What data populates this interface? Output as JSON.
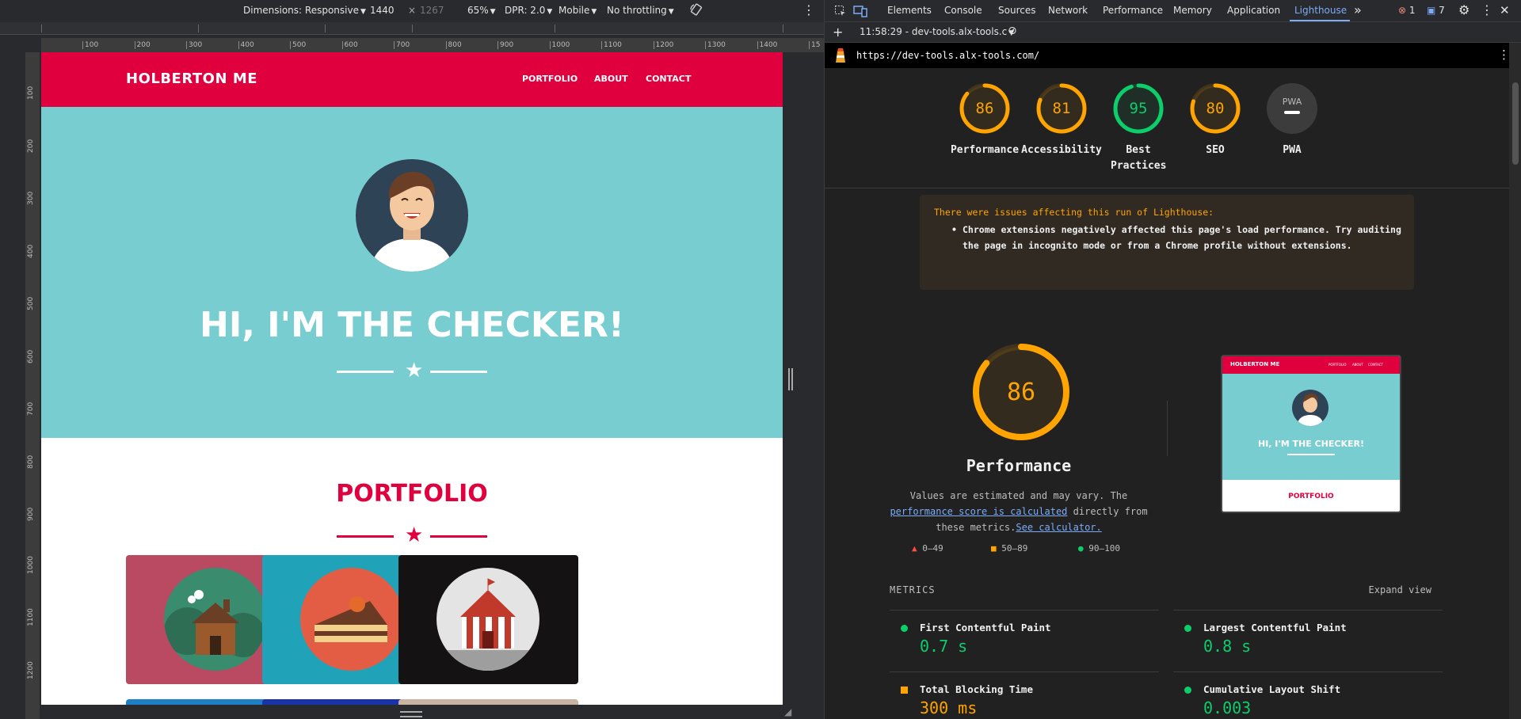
{
  "device_toolbar": {
    "dimensions_label": "Dimensions: Responsive",
    "width": "1440",
    "times": "×",
    "height": "1267",
    "zoom": "65%",
    "dpr": "DPR: 2.0",
    "device_type": "Mobile",
    "throttling": "No throttling"
  },
  "rulers": {
    "h_ticks": [
      "100",
      "200",
      "300",
      "400",
      "500",
      "600",
      "700",
      "800",
      "900",
      "1000",
      "1100",
      "1200",
      "1300",
      "1400",
      "15"
    ],
    "v_ticks": [
      "100",
      "200",
      "300",
      "400",
      "500",
      "600",
      "700",
      "800",
      "900",
      "1000",
      "1100",
      "1200"
    ]
  },
  "site": {
    "brand": "HOLBERTON ME",
    "nav": [
      "PORTFOLIO",
      "ABOUT",
      "CONTACT"
    ],
    "hero_title": "HI, I'M THE CHECKER!",
    "portfolio_title": "PORTFOLIO",
    "colors": {
      "primary": "#e0003e",
      "hero": "#78cdd1"
    },
    "cards": [
      {
        "bg": "#b94a62",
        "icon": "log-cabin-icon"
      },
      {
        "bg": "#20a3b8",
        "icon": "cake-slice-icon"
      },
      {
        "bg": "#141212",
        "icon": "circus-tent-icon"
      }
    ],
    "cards_row2": [
      "#1d7fc4",
      "#1a34a8",
      "#c9b3a3"
    ]
  },
  "devtools": {
    "tabs": [
      "Elements",
      "Console",
      "Sources",
      "Network",
      "Performance",
      "Memory",
      "Application",
      "Lighthouse"
    ],
    "active_tab": "Lighthouse",
    "more": "»",
    "errors": "1",
    "messages": "7",
    "run_time": "11:58:29 - dev-tools.alx-tools.c",
    "url": "https://dev-tools.alx-tools.com/"
  },
  "scores": [
    {
      "value": "86",
      "label": "Performance",
      "color": "#ffa400",
      "pct": 0.86
    },
    {
      "value": "81",
      "label": "Accessibility",
      "color": "#ffa400",
      "pct": 0.81
    },
    {
      "value": "95",
      "label": "Best Practices",
      "color": "#0cce6b",
      "pct": 0.95
    },
    {
      "value": "80",
      "label": "SEO",
      "color": "#ffa400",
      "pct": 0.8
    },
    {
      "value": "PWA",
      "label": "PWA",
      "color": "#9e9e9e",
      "pct": 0
    }
  ],
  "warning": {
    "title": "There were issues affecting this run of Lighthouse:",
    "item": "Chrome extensions negatively affected this page's load performance. Try auditing the page in incognito mode or from a Chrome profile without extensions."
  },
  "performance": {
    "score": "86",
    "pct": 0.86,
    "label": "Performance",
    "note_before": "Values are estimated and may vary. The",
    "note_link": "performance score is calculated",
    "note_after": "directly from these metrics.",
    "calc_link": "See calculator."
  },
  "legend": [
    "0–49",
    "50–89",
    "90–100"
  ],
  "metrics_header": "METRICS",
  "expand_view": "Expand view",
  "metrics": [
    {
      "name": "First Contentful Paint",
      "value": "0.7 s",
      "status": "pass"
    },
    {
      "name": "Largest Contentful Paint",
      "value": "0.8 s",
      "status": "pass"
    },
    {
      "name": "Total Blocking Time",
      "value": "300 ms",
      "status": "average"
    },
    {
      "name": "Cumulative Layout Shift",
      "value": "0.003",
      "status": "pass"
    }
  ],
  "thumbnail": {
    "brand": "HOLBERTON ME",
    "nav": [
      "PORTFOLIO",
      "ABOUT",
      "CONTACT"
    ],
    "hero_title": "HI, I'M THE CHECKER!",
    "portfolio_title": "PORTFOLIO"
  }
}
